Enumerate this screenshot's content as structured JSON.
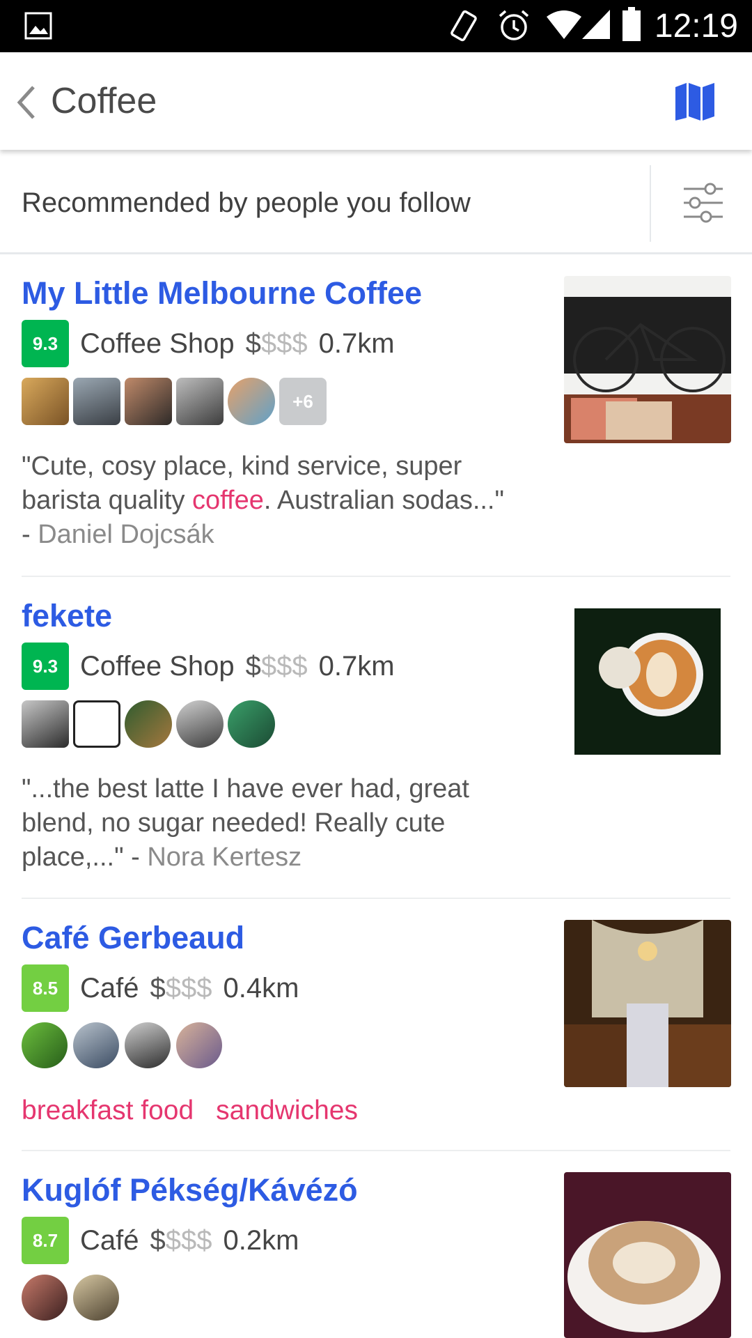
{
  "status_bar": {
    "time": "12:19",
    "icons": [
      "image-icon",
      "rotate-icon",
      "alarm-icon",
      "wifi-icon",
      "signal-icon",
      "battery-icon"
    ]
  },
  "app_bar": {
    "title": "Coffee",
    "back_icon": "chevron-left-icon",
    "map_icon": "map-icon",
    "accent": "#2d5be3"
  },
  "filter": {
    "label": "Recommended by people you follow",
    "icon": "sliders-icon"
  },
  "colors": {
    "link": "#2d5be3",
    "highlight": "#e5366f",
    "score_dark_green": "#00b551",
    "score_light_green": "#73cf42"
  },
  "venues": [
    {
      "name": "My Little Melbourne Coffee",
      "score": "9.3",
      "score_color": "#00b551",
      "category": "Coffee Shop",
      "price_active": "$",
      "price_inactive": "$$$",
      "distance": "0.7km",
      "more_followers": "+6",
      "tip_before": "\"Cute, cosy place, kind service, super barista quality ",
      "tip_highlight": "coffee",
      "tip_after": ". Australian sodas...\" - ",
      "tip_author": "Daniel Dojcsák"
    },
    {
      "name": "fekete",
      "score": "9.3",
      "score_color": "#00b551",
      "category": "Coffee Shop",
      "price_active": "$",
      "price_inactive": "$$$",
      "distance": "0.7km",
      "tip_text": "\"...the best latte I have ever had, great blend, no sugar needed! Really cute place,...\" - ",
      "tip_author": "Nora Kertesz"
    },
    {
      "name": "Café Gerbeaud",
      "score": "8.5",
      "score_color": "#73cf42",
      "category": "Café",
      "price_active": "$",
      "price_inactive": "$$$",
      "distance": "0.4km",
      "tags": [
        "breakfast food",
        "sandwiches"
      ]
    },
    {
      "name": "Kuglóf Pékség/Kávézó",
      "score": "8.7",
      "score_color": "#73cf42",
      "category": "Café",
      "price_active": "$",
      "price_inactive": "$$$",
      "distance": "0.2km"
    }
  ]
}
